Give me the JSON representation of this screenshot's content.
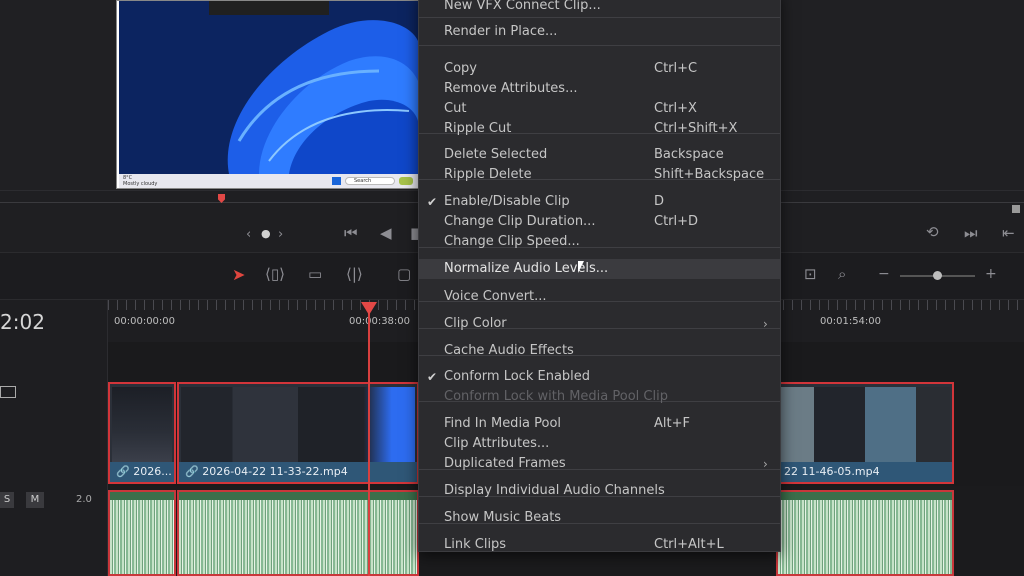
{
  "viewer": {
    "preview_taskbar_search": "Search",
    "preview_weather": "8°C",
    "preview_weather_sub": "Mostly cloudy"
  },
  "timeline": {
    "current_timecode": "2:02",
    "ruler": [
      "00:00:00:00",
      "00:00:38:00",
      "00:01:54:00"
    ],
    "video_clips": [
      "2026...",
      "2026-04-22 11-33-22.mp4",
      "22 11-46-05.mp4"
    ],
    "audio_track": {
      "solo": "S",
      "mute": "M",
      "level": "2.0"
    }
  },
  "context_menu": {
    "items": [
      {
        "label": "New VFX Connect Clip...",
        "shortcut": ""
      },
      {
        "label": "Render in Place...",
        "shortcut": ""
      },
      {
        "label": "Copy",
        "shortcut": "Ctrl+C"
      },
      {
        "label": "Remove Attributes...",
        "shortcut": ""
      },
      {
        "label": "Cut",
        "shortcut": "Ctrl+X"
      },
      {
        "label": "Ripple Cut",
        "shortcut": "Ctrl+Shift+X"
      },
      {
        "label": "Delete Selected",
        "shortcut": "Backspace"
      },
      {
        "label": "Ripple Delete",
        "shortcut": "Shift+Backspace"
      },
      {
        "label": "Enable/Disable Clip",
        "shortcut": "D",
        "checked": true
      },
      {
        "label": "Change Clip Duration...",
        "shortcut": "Ctrl+D"
      },
      {
        "label": "Change Clip Speed...",
        "shortcut": ""
      },
      {
        "label": "Normalize Audio Levels...",
        "shortcut": "",
        "highlighted": true
      },
      {
        "label": "Voice Convert...",
        "shortcut": ""
      },
      {
        "label": "Clip Color",
        "shortcut": "",
        "submenu": true
      },
      {
        "label": "Cache Audio Effects",
        "shortcut": ""
      },
      {
        "label": "Conform Lock Enabled",
        "shortcut": "",
        "checked": true
      },
      {
        "label": "Conform Lock with Media Pool Clip",
        "shortcut": "",
        "disabled": true
      },
      {
        "label": "Find In Media Pool",
        "shortcut": "Alt+F"
      },
      {
        "label": "Clip Attributes...",
        "shortcut": ""
      },
      {
        "label": "Duplicated Frames",
        "shortcut": "",
        "submenu": true
      },
      {
        "label": "Display Individual Audio Channels",
        "shortcut": ""
      },
      {
        "label": "Show Music Beats",
        "shortcut": ""
      },
      {
        "label": "Link Clips",
        "shortcut": "Ctrl+Alt+L"
      }
    ]
  },
  "colors": {
    "menu_bg": "#2b2b2e",
    "clip_border": "#d2353a",
    "clip_label": "#2f5777",
    "playhead": "#e24846",
    "audio": "#3c6f4b"
  },
  "icons": [
    "checkmark-icon",
    "chevron-right-icon",
    "selection-tool-icon",
    "trim-tool-icon",
    "blade-tool-icon",
    "zoom-icon",
    "skip-back-icon",
    "play-reverse-icon",
    "loop-icon",
    "skip-forward-icon",
    "video-track-icon"
  ]
}
